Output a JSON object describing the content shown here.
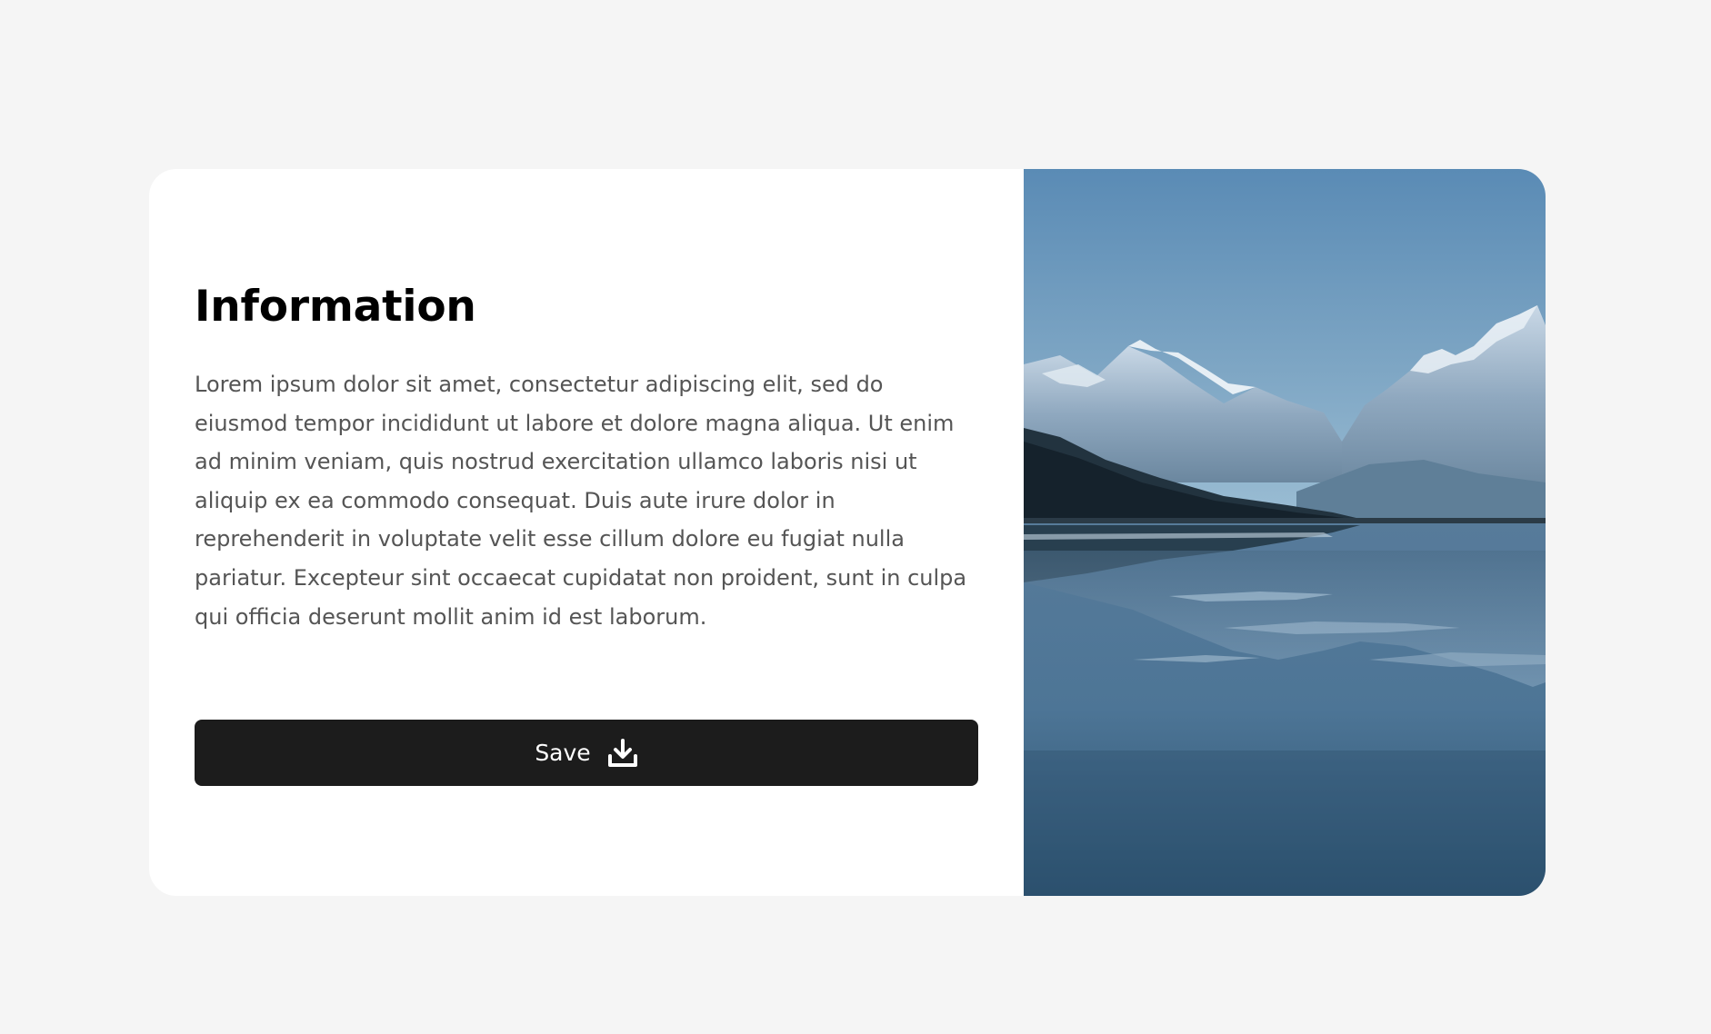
{
  "card": {
    "title": "Information",
    "body": "Lorem ipsum dolor sit amet, consectetur adipiscing elit, sed do eiusmod tempor incididunt ut labore et dolore magna aliqua. Ut enim ad minim veniam, quis nostrud exercitation ullamco laboris nisi ut aliquip ex ea commodo consequat. Duis aute irure dolor in reprehenderit in voluptate velit esse cillum dolore eu fugiat nulla pariatur. Excepteur sint occaecat cupidatat non proident, sunt in culpa qui officia deserunt mollit anim id est laborum.",
    "save_label": "Save",
    "save_icon": "download-icon"
  },
  "colors": {
    "page_background": "#f5f5f5",
    "card_background": "#ffffff",
    "button_background": "#1c1c1c",
    "button_text": "#ffffff",
    "title_text": "#000000",
    "body_text": "#555555"
  },
  "image": {
    "subject": "mountain-lake-landscape"
  }
}
